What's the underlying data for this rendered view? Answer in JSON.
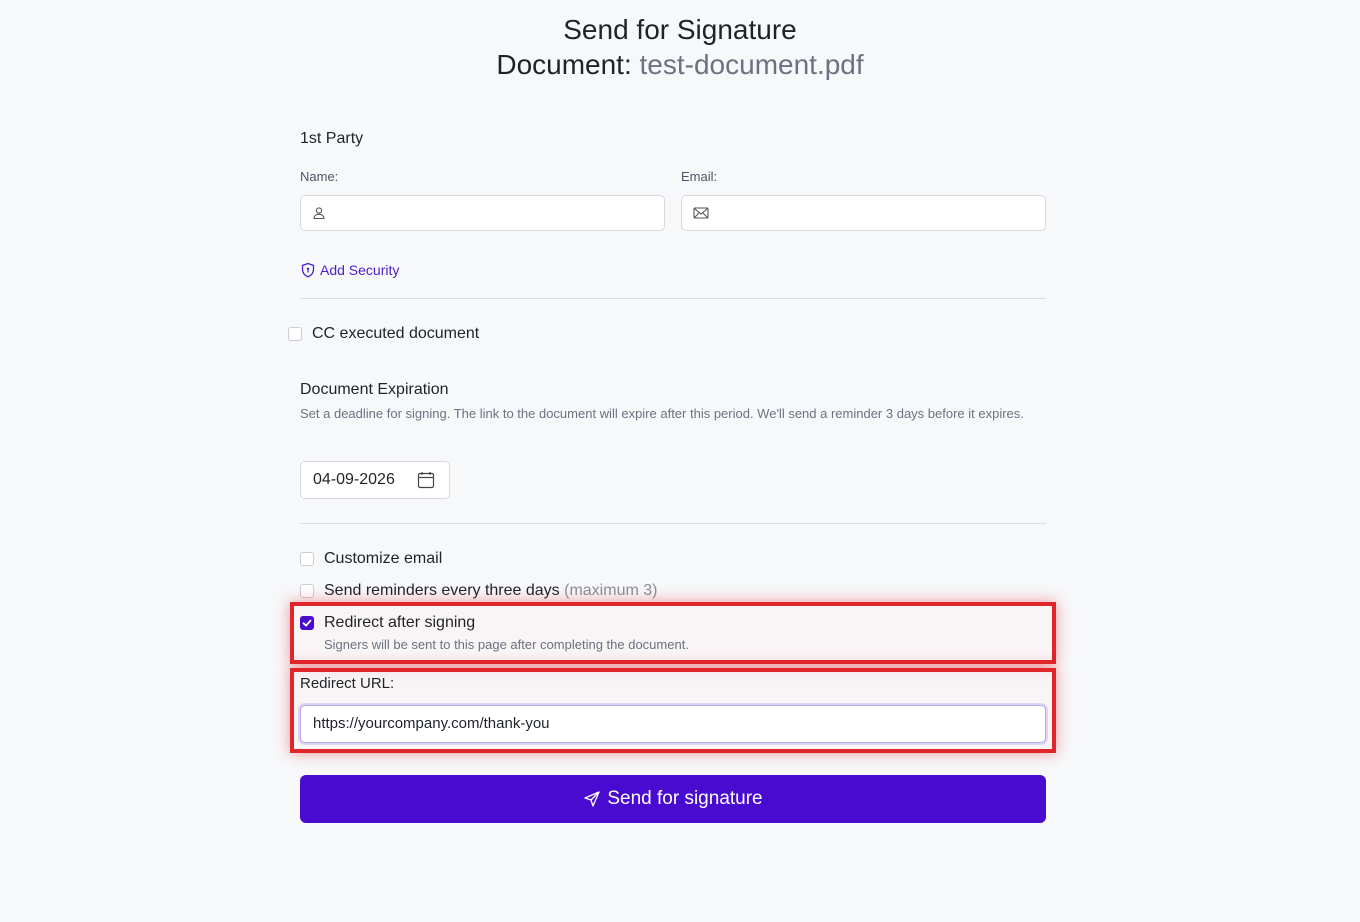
{
  "header": {
    "title": "Send for Signature",
    "document_label": "Document:",
    "document_name": "test-document.pdf"
  },
  "party": {
    "heading": "1st Party",
    "name_label": "Name:",
    "name_value": "",
    "email_label": "Email:",
    "email_value": "",
    "add_security_label": "Add Security"
  },
  "cc": {
    "label": "CC executed document",
    "checked": false
  },
  "expiration": {
    "title": "Document Expiration",
    "description": "Set a deadline for signing. The link to the document will expire after this period. We'll send a reminder 3 days before it expires.",
    "date_value": "04-09-2026"
  },
  "options": {
    "customize_email_label": "Customize email",
    "reminders_label": "Send reminders every three days",
    "reminders_note": "(maximum 3)",
    "redirect_label": "Redirect after signing",
    "redirect_checked": true,
    "redirect_description": "Signers will be sent to this page after completing the document."
  },
  "redirect_url": {
    "label": "Redirect URL:",
    "value": "https://yourcompany.com/thank-you"
  },
  "submit": {
    "label": "Send for signature"
  },
  "colors": {
    "accent": "#4a0bd1",
    "highlight": "#e0262b"
  },
  "icons": {
    "name_field": "user-icon",
    "email_field": "mail-icon",
    "security": "shield-icon",
    "date": "calendar-icon",
    "submit": "send-icon"
  }
}
